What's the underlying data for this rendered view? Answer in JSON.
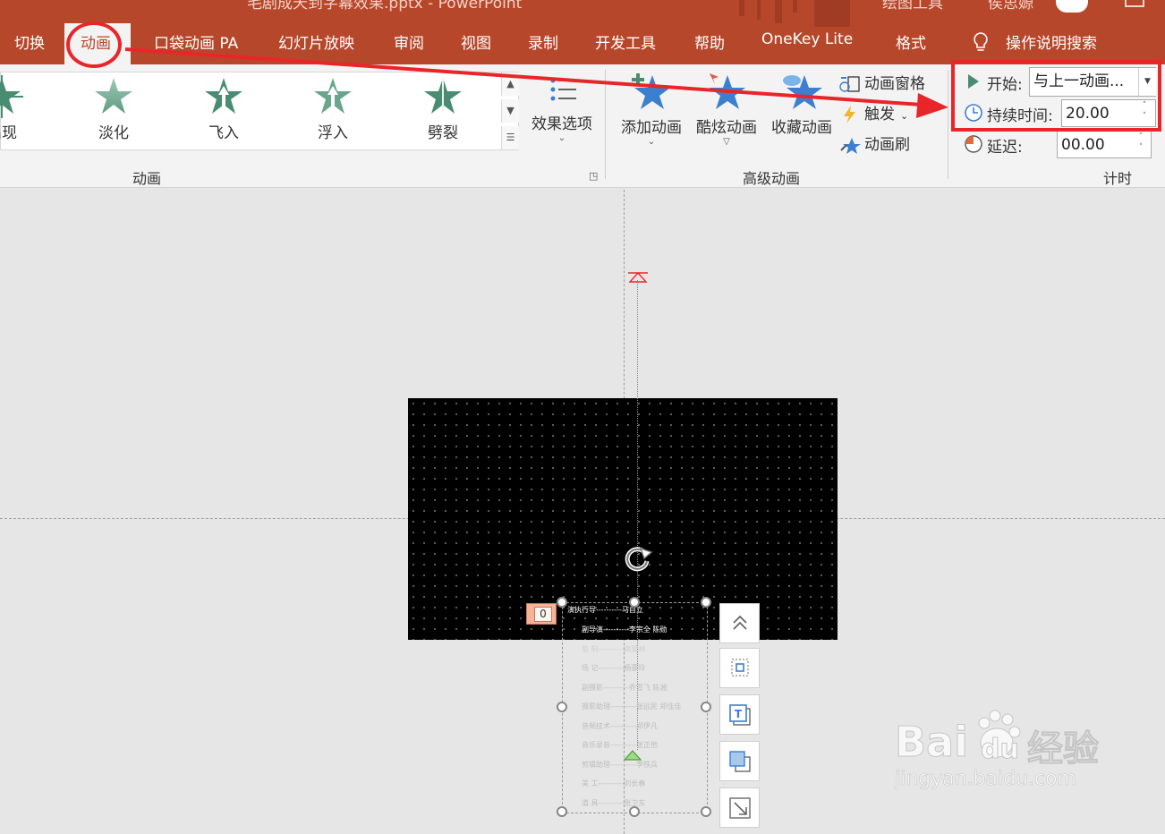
{
  "titlebar": {
    "title_fragment": "毛剧成天到字幕效果.pptx  -  PowerPoint",
    "drawing_tools_fragment": "绘图工具",
    "user_fragment": "侯思嫄"
  },
  "tabs": [
    {
      "label": "切换"
    },
    {
      "label": "动画"
    },
    {
      "label": "口袋动画 PA"
    },
    {
      "label": "幻灯片放映"
    },
    {
      "label": "审阅"
    },
    {
      "label": "视图"
    },
    {
      "label": "录制"
    },
    {
      "label": "开发工具"
    },
    {
      "label": "帮助"
    },
    {
      "label": "OneKey Lite"
    },
    {
      "label": "格式"
    },
    {
      "label": "操作说明搜索"
    }
  ],
  "gallery": {
    "items": [
      {
        "label": "出现",
        "icon": "burst-star-icon"
      },
      {
        "label": "淡化",
        "icon": "fade-star-icon"
      },
      {
        "label": "飞入",
        "icon": "fly-in-star-icon"
      },
      {
        "label": "浮入",
        "icon": "float-in-star-icon"
      },
      {
        "label": "劈裂",
        "icon": "split-star-icon"
      }
    ],
    "effect_options": "效果选项",
    "group_label": "动画"
  },
  "advanced": {
    "add_animation": "添加动画",
    "cool_animation": "酷炫动画",
    "favorite_animation": "收藏动画",
    "animation_pane": "动画窗格",
    "trigger": "触发",
    "animation_painter": "动画刷",
    "group_label": "高级动画"
  },
  "timing": {
    "start_label": "开始:",
    "start_value": "与上一动画...",
    "duration_label": "持续时间:",
    "duration_value": "20.00",
    "delay_label": "延迟:",
    "delay_value": "00.00",
    "group_label": "计时"
  },
  "slide": {
    "animation_tag": "0",
    "credits": [
      "演执行导----------马自立",
      "副导演----------李宗全 陈勋",
      "监 制----------高爱林",
      "场 记----------杨豪玲",
      "副摄影----------乔雪飞 陈湘",
      "摄影助理----------张远民 郑佳佳",
      "音频技术----------郑伊凡",
      "音乐录音----------张正他",
      "剪辑助理----------李铁兵",
      "美 工----------刘长春",
      "道 具----------张卫东"
    ]
  },
  "watermark": {
    "brand": "Bai",
    "brand2": "du",
    "brand_cn": "经验",
    "url": "jingyan.baidu.com"
  },
  "colors": {
    "accent": "#b7472a",
    "annotation_red": "#e8262a",
    "star_blue": "#3d7fcf",
    "star_green": "#4a8c72"
  }
}
